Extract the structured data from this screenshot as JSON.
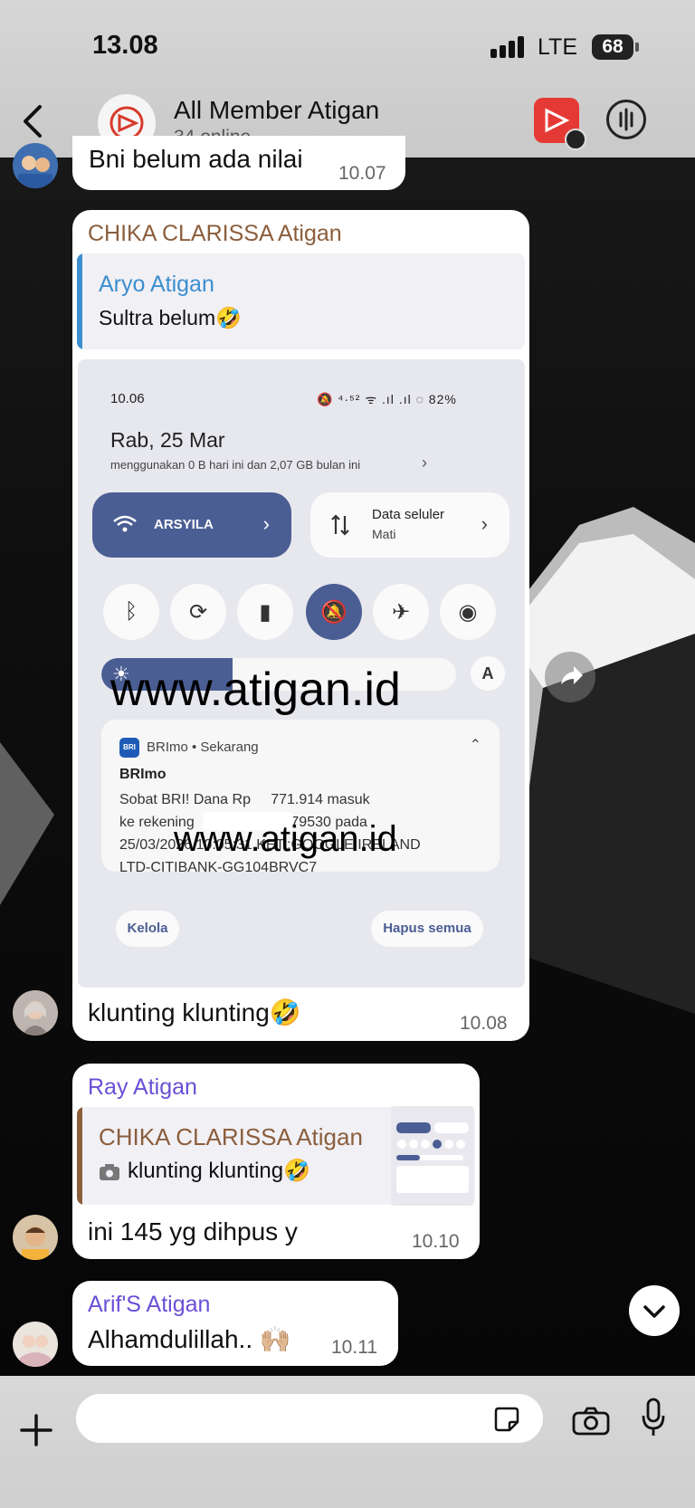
{
  "status_bar": {
    "time": "13.08",
    "network": "LTE",
    "battery": "68"
  },
  "header": {
    "title": "All Member Atigan",
    "subtitle": "34 online"
  },
  "messages": [
    {
      "text": "Bni belum ada nilai",
      "time": "10.07"
    },
    {
      "sender": "CHIKA CLARISSA Atigan",
      "reply": {
        "sender": "Aryo Atigan",
        "text": "Sultra belum🤣"
      },
      "text": "klunting klunting🤣",
      "time": "10.08"
    },
    {
      "sender": "Ray Atigan",
      "reply": {
        "sender": "CHIKA CLARISSA Atigan",
        "text": "klunting klunting🤣"
      },
      "text": "ini 145 yg dihpus y",
      "time": "10.10"
    },
    {
      "sender": "Arif'S Atigan",
      "text": "Alhamdulillah.. 🙌🏼",
      "time": "10.11"
    }
  ],
  "screenshot": {
    "time": "10.06",
    "status_icons": "🔕 ⁴·⁵² ᯤ .ıl .ıl ◌ 82%",
    "date": "Rab, 25 Mar",
    "usage": "menggunakan 0 B hari ini dan 2,07 GB bulan ini",
    "wifi_label": "ARSYILA",
    "data_label": "Data seluler",
    "data_state": "Mati",
    "notification": {
      "app": "BRImo • Sekarang",
      "title": "BRImo",
      "body": "Sobat BRI! Dana Rp     771.914 masuk\nke rekening                        79530 pada\n25/03/2026 10:05:31 KET.:GOOGLE IRELAND\nLTD-CITIBANK-GG104BRVC7"
    },
    "btn_manage": "Kelola",
    "btn_clear": "Hapus semua",
    "auto_label": "A",
    "brightness": 0.37
  },
  "watermark": "www.atigan.id",
  "input": {
    "placeholder": ""
  }
}
